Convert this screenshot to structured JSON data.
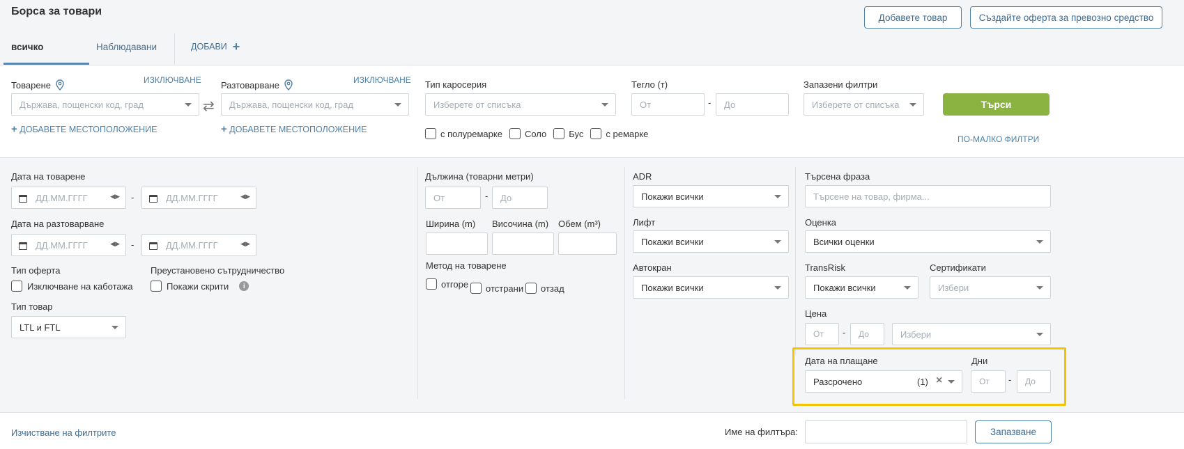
{
  "header": {
    "title": "Борса за товари",
    "add_cargo": "Добавете товар",
    "create_vehicle_offer": "Създайте оферта за превозно средство"
  },
  "tabs": [
    {
      "label": "всичко"
    },
    {
      "label": "Наблюдавани"
    },
    {
      "label": "ДОБАВИ",
      "icon": "plus-icon"
    }
  ],
  "filters": {
    "loading": {
      "label": "Товарене",
      "exclude": "ИЗКЛЮЧВАНЕ",
      "placeholder": "Държава, пощенски код, град",
      "add_location": "ДОБАВЕТЕ МЕСТОПОЛОЖЕНИЕ"
    },
    "unloading": {
      "label": "Разтоварване",
      "exclude": "ИЗКЛЮЧВАНЕ",
      "placeholder": "Държава, пощенски код, град",
      "add_location": "ДОБАВЕТЕ МЕСТОПОЛОЖЕНИЕ"
    },
    "body_type": {
      "label": "Тип каросерия",
      "placeholder": "Изберете от списъка",
      "options": [
        "с полуремарке",
        "Соло",
        "Бус",
        "с ремарке"
      ]
    },
    "weight": {
      "label": "Тегло (т)",
      "from": "От",
      "to": "До",
      "dash": "-"
    },
    "saved_filters": {
      "label": "Запазени филтри",
      "placeholder": "Изберете от списъка"
    },
    "search_button": "Търси",
    "fewer_filters": "ПО-МАЛКО ФИЛТРИ"
  },
  "advanced": {
    "loading_date": {
      "label": "Дата на товарене",
      "placeholder": "ДД.ММ.ГГГГ"
    },
    "unloading_date": {
      "label": "Дата на разтоварване",
      "placeholder": "ДД.ММ.ГГГГ"
    },
    "offer_type": {
      "label": "Тип оферта",
      "option": "Изключване на каботажа"
    },
    "suspended": {
      "label": "Преустановено сътрудничество",
      "option": "Покажи скрити"
    },
    "cargo_type": {
      "label": "Тип товар",
      "value": "LTL и FTL"
    },
    "length": {
      "label": "Дължина (товарни метри)",
      "from": "От",
      "to": "До"
    },
    "width": {
      "label": "Ширина (m)"
    },
    "height": {
      "label": "Височина (m)"
    },
    "volume": {
      "label": "Обем (m³)"
    },
    "loading_method": {
      "label": "Метод на товарене",
      "options": [
        "отгоре",
        "отстрани",
        "отзад"
      ]
    },
    "adr": {
      "label": "ADR",
      "value": "Покажи всички"
    },
    "lift": {
      "label": "Лифт",
      "value": "Покажи всички"
    },
    "crane": {
      "label": "Автокран",
      "value": "Покажи всички"
    },
    "phrase": {
      "label": "Търсена фраза",
      "placeholder": "Търсене на товар, фирма..."
    },
    "rating": {
      "label": "Оценка",
      "value": "Всички оценки"
    },
    "transrisk": {
      "label": "TransRisk",
      "value": "Покажи всички"
    },
    "certificates": {
      "label": "Сертификати",
      "placeholder": "Избери"
    },
    "price": {
      "label": "Цена",
      "from": "От",
      "to": "До",
      "currency_placeholder": "Избери"
    },
    "payment_date": {
      "label": "Дата на плащане",
      "value": "Разсрочено",
      "count": "(1)"
    },
    "days": {
      "label": "Дни",
      "from": "От",
      "to": "До"
    }
  },
  "footer": {
    "clear": "Изчистване на филтрите",
    "filter_name_label": "Име на филтъра:",
    "save": "Запазване"
  },
  "colors": {
    "accent": "#4e81a8",
    "green": "#8ab342",
    "highlight": "#f4c400"
  }
}
